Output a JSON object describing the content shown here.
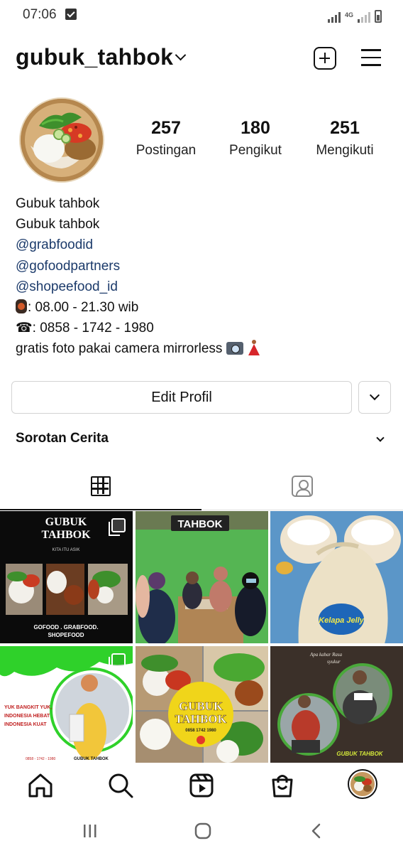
{
  "status_bar": {
    "time": "07:06",
    "network": "4G"
  },
  "header": {
    "username": "gubuk_tahbok"
  },
  "stats": [
    {
      "value": "257",
      "label": "Postingan"
    },
    {
      "value": "180",
      "label": "Pengikut"
    },
    {
      "value": "251",
      "label": "Mengikuti"
    }
  ],
  "bio": {
    "name": "Gubuk tahbok",
    "category": "Gubuk tahbok",
    "mention_1": "@grabfoodid",
    "mention_2": "@gofoodpartners",
    "mention_3": "@shopeefood_id",
    "hours": ": 08.00 - 21.30 wib",
    "phone_symbol": "☎",
    "phone": ": 0858 - 1742 - 1980",
    "tagline": "gratis foto pakai camera mirrorless"
  },
  "buttons": {
    "edit_profile": "Edit Profil"
  },
  "highlights": {
    "label": "Sorotan Cerita"
  },
  "posts": {
    "post1": {
      "title_line1": "GUBUK",
      "title_line2": "TAHBOK",
      "subtitle": "KITA ITU ASIK",
      "footer_line1": "GOFOOD . GRABFOOD.",
      "footer_line2": "SHOPEFOOD"
    },
    "post2": {
      "sign": "TAHBOK"
    },
    "post3": {
      "label": "Kelapa Jelly"
    },
    "post4": {
      "line1": "YUK BANGKIT YUK,",
      "line2": "INDONESIA HEBAT",
      "line3": "INDONESIA KUAT",
      "footer": "GUBUK TAHBOK",
      "phone": "0858 - 1742 - 1980"
    },
    "post5": {
      "title_line1": "GUBUK",
      "title_line2": "TAHBOK",
      "phone": "0858 1742 1980"
    },
    "post6": {
      "caption_line1": "Apa kabar Rasa",
      "caption_line2": "syukur",
      "footer": "GUBUK TAHBOK"
    }
  },
  "colors": {
    "link": "#1c3b6b",
    "border": "#d3d3d3",
    "green_banner": "#2fd12a"
  }
}
